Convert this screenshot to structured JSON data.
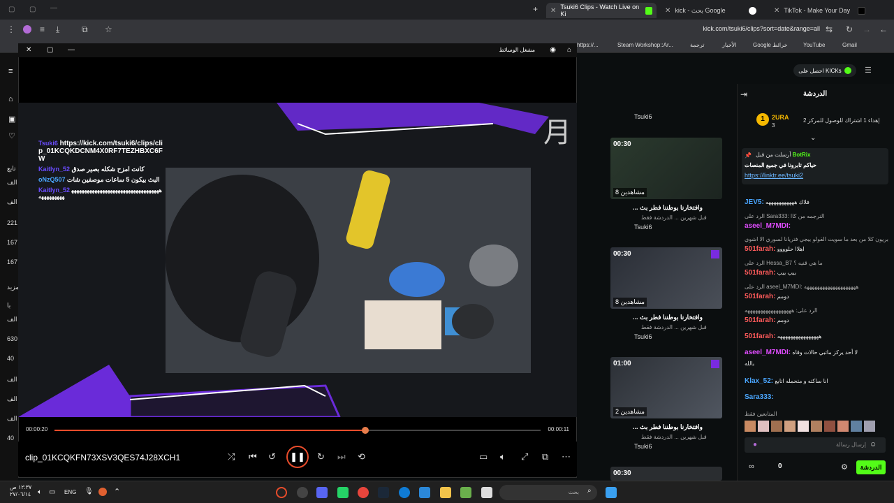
{
  "browser": {
    "tabs": [
      {
        "label": "Tsuki6 Clips - Watch Live on Ki",
        "active": true
      },
      {
        "label": "kick - بحث Google"
      },
      {
        "label": "TikTok - Make Your Day"
      }
    ],
    "url": "kick.com/tsuki6/clips?sort=date&range=all",
    "bookmarks": [
      "https://...",
      "Steam Workshop::Ar...",
      "ترجمة",
      "الأخبار",
      "Google خرائط",
      "YouTube",
      "Gmail"
    ]
  },
  "left_nav": {
    "counts": [
      "تابع",
      "الف",
      "الف",
      "221",
      "167",
      "167",
      "مزيد",
      "با",
      "الف",
      "630",
      "40",
      "الف",
      "الف",
      "الف",
      "40"
    ]
  },
  "clips": [
    {
      "duration": "00:30",
      "views": "8 مشاهدين",
      "title": "... وافتخارنا بوطننا فطر بث",
      "sub": "قبل شهرين ... الدردشة فقط",
      "channel": "Tsuki6"
    },
    {
      "duration": "00:30",
      "views": "8 مشاهدين",
      "title": "... وافتخارنا بوطننا فطر بث",
      "sub": "قبل شهرين ... الدردشة فقط",
      "channel": "Tsuki6"
    },
    {
      "duration": "01:00",
      "views": "2 مشاهدين",
      "title": "... وافتخارنا بوطننا فطر بث",
      "sub": "قبل شهرين ... الدردشة فقط",
      "channel": "Tsuki6"
    },
    {
      "duration": "00:30"
    }
  ],
  "top_channel_name": "Tsuki6",
  "chat": {
    "title": "الدردشة",
    "kicks_button": "احصل على KICKs",
    "top_gifter": {
      "name": "2URA",
      "count": "3"
    },
    "goal_text": "إهداء 1 اشتراك للوصول للمركز 2",
    "pinned": {
      "by": "أرسلت من قبل",
      "user": "BotRix",
      "text": "حياكم تابرونا في جميع المنصات",
      "link": "https://linktr.ee/tsuki2"
    },
    "messages": [
      {
        "user": "JEV5:",
        "text": "فلاك هههههههههههه",
        "color": "#4aa6ff"
      },
      {
        "user": "",
        "text": "الرد على Sara333: الترجمه من كاا",
        "color": "#aaa"
      },
      {
        "user": "aseel_M7MDI:",
        "text": "",
        "color": "#e04cff"
      },
      {
        "user": "",
        "text": "بريون كلا من بعد ما سويت القولو بيجي فتريانا لسوري الا اشوي",
        "color": "#aaa"
      },
      {
        "user": "501farah:",
        "text": "اهلاا حلوووو",
        "color": "#ff5b5b"
      },
      {
        "user": "",
        "text": "الرد على Hessa_B7 ما هي قنيه ؟",
        "color": "#aaa"
      },
      {
        "user": "501farah:",
        "text": "ببب ببب",
        "color": "#ff5b5b"
      },
      {
        "user": "",
        "text": "الرد على aseel_M7MDI: ههههههههههههههههههههه",
        "color": "#aaa"
      },
      {
        "user": "501farah:",
        "text": "دومم",
        "color": "#ff5b5b"
      },
      {
        "user": "",
        "text": "الرد على: ههههههههههههههههههه",
        "color": "#aaa"
      },
      {
        "user": "501farah:",
        "text": "دومم",
        "color": "#ff5b5b"
      },
      {
        "user": "501farah:",
        "text": "ههههههههههههههههه",
        "color": "#ff5b5b"
      },
      {
        "user": "aseel_M7MDI:",
        "text": "لا أحد يركز ماتبي حالات وقاه",
        "color": "#e04cff"
      },
      {
        "user": "",
        "text": "بالله",
        "color": "#e6e6e6"
      },
      {
        "user": "Klax_52:",
        "text": "انا ساكته و متحمله اتابع",
        "color": "#4aa6ff"
      },
      {
        "user": "Sara333:",
        "text": "",
        "color": "#4aa6ff"
      },
      {
        "user": "",
        "text": "المتابعين فقط",
        "color": "#aaa"
      }
    ],
    "input_placeholder": "إرسال رسالة",
    "send_label": "الدردشة",
    "viewer_count": "0"
  },
  "player": {
    "window_title": "مشغل الوسائط",
    "overlay_chat": [
      {
        "user": "Tsuki6",
        "text": "https://kick.com/tsuki6/clips/clip_01KCQKDCNM4X0RF7TEZHBXC6FW"
      },
      {
        "user": "Kaitlyn_52",
        "text": "كانت امزح شكله بصير صدق"
      },
      {
        "user": "oNzQ507",
        "text": "البث بيكون 5 ساعات موصفين شات"
      },
      {
        "user": "Kaitlyn_52",
        "text": "ههههههههههههههههههههههههههههههههههههههههههههه"
      }
    ],
    "time_current": "00:00:20",
    "time_remaining": "00:00:11",
    "progress": 0.64,
    "clip_name": "clip_01KCQKFN73XSV3QES74J28XCH1"
  },
  "taskbar": {
    "time": "١٢:٣٧ ص",
    "date": "٢٧/٠٦/١٤",
    "lang": "ENG",
    "search_placeholder": "بحث"
  }
}
